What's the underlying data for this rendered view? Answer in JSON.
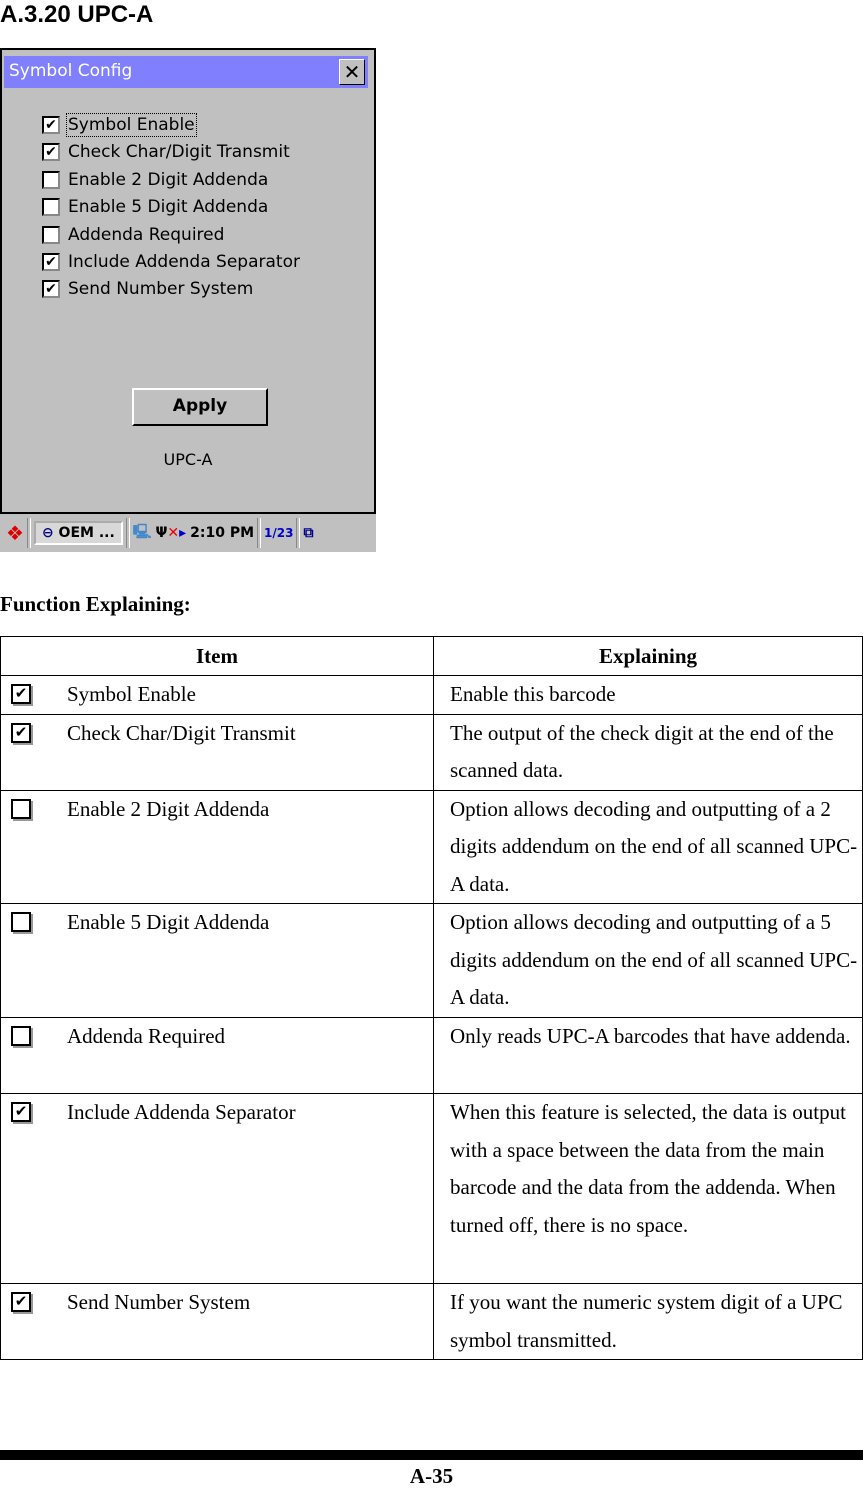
{
  "heading": "A.3.20 UPC-A",
  "screenshot": {
    "title": "Symbol Config",
    "close_glyph": "✕",
    "checkboxes": [
      {
        "label": "Symbol Enable",
        "checked": true
      },
      {
        "label": "Check Char/Digit Transmit",
        "checked": true
      },
      {
        "label": "Enable 2 Digit Addenda",
        "checked": false
      },
      {
        "label": "Enable 5 Digit Addenda",
        "checked": false
      },
      {
        "label": "Addenda Required",
        "checked": false
      },
      {
        "label": "Include Addenda Separator",
        "checked": true
      },
      {
        "label": "Send Number System",
        "checked": true
      }
    ],
    "apply_label": "Apply",
    "symbology_label": "UPC-A",
    "taskbar": {
      "task_label": "OEM ...",
      "clock": "2:10 PM",
      "input_label": "1/23"
    }
  },
  "function_heading": "Function Explaining:",
  "table": {
    "headers": [
      "Item",
      "Explaining"
    ],
    "rows": [
      {
        "item": "Symbol Enable",
        "checked": true,
        "explaining": "Enable this barcode"
      },
      {
        "item": "Check Char/Digit Transmit",
        "checked": true,
        "explaining": "The output of the check digit at the end of the scanned data."
      },
      {
        "item": "Enable 2 Digit Addenda",
        "checked": false,
        "explaining": "Option allows decoding and outputting of a 2 digits addendum on the end of all scanned UPC-A data."
      },
      {
        "item": "Enable 5 Digit Addenda",
        "checked": false,
        "explaining": "Option allows decoding and outputting of a 5 digits addendum on the end of all scanned UPC-A data."
      },
      {
        "item": "Addenda Required",
        "checked": false,
        "explaining": "Only reads UPC-A barcodes that have addenda."
      },
      {
        "item": "Include Addenda Separator",
        "checked": true,
        "explaining": "When this feature is selected, the data is output with a space between the data from the main barcode and the data from the addenda. When turned off, there is no space."
      },
      {
        "item": "Send Number System",
        "checked": true,
        "explaining": "If you want the numeric system digit of a UPC symbol transmitted."
      }
    ]
  },
  "page_number": "A-35"
}
